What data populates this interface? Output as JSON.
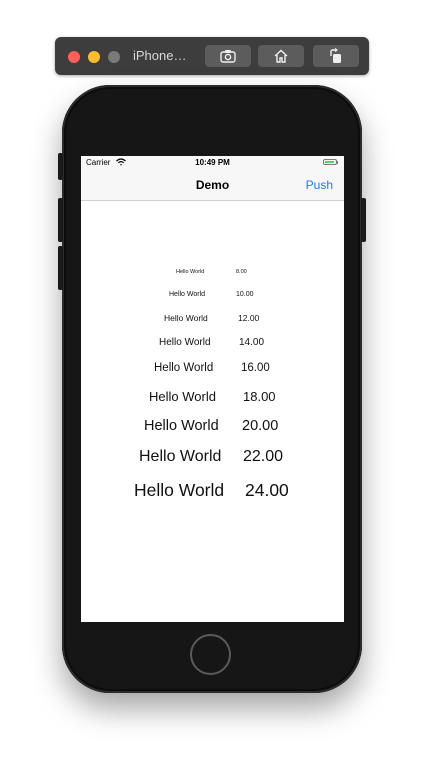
{
  "simulator": {
    "title": "iPhone…",
    "buttons": {
      "screenshot_icon": "camera-icon",
      "home_icon": "home-icon",
      "rotate_icon": "rotate-icon"
    }
  },
  "status_bar": {
    "carrier": "Carrier",
    "time": "10:49 PM",
    "battery_level": 0.85
  },
  "nav_bar": {
    "title": "Demo",
    "right_button": "Push"
  },
  "rows": [
    {
      "label": "Hello World",
      "value": "8.00"
    },
    {
      "label": "Hello World",
      "value": "10.00"
    },
    {
      "label": "Hello World",
      "value": "12.00"
    },
    {
      "label": "Hello World",
      "value": "14.00"
    },
    {
      "label": "Hello World",
      "value": "16.00"
    },
    {
      "label": "Hello World",
      "value": "18.00"
    },
    {
      "label": "Hello World",
      "value": "20.00"
    },
    {
      "label": "Hello World",
      "value": "22.00"
    },
    {
      "label": "Hello World",
      "value": "24.00"
    }
  ],
  "colors": {
    "accent": "#1a7cf6",
    "battery": "#4cd964"
  }
}
